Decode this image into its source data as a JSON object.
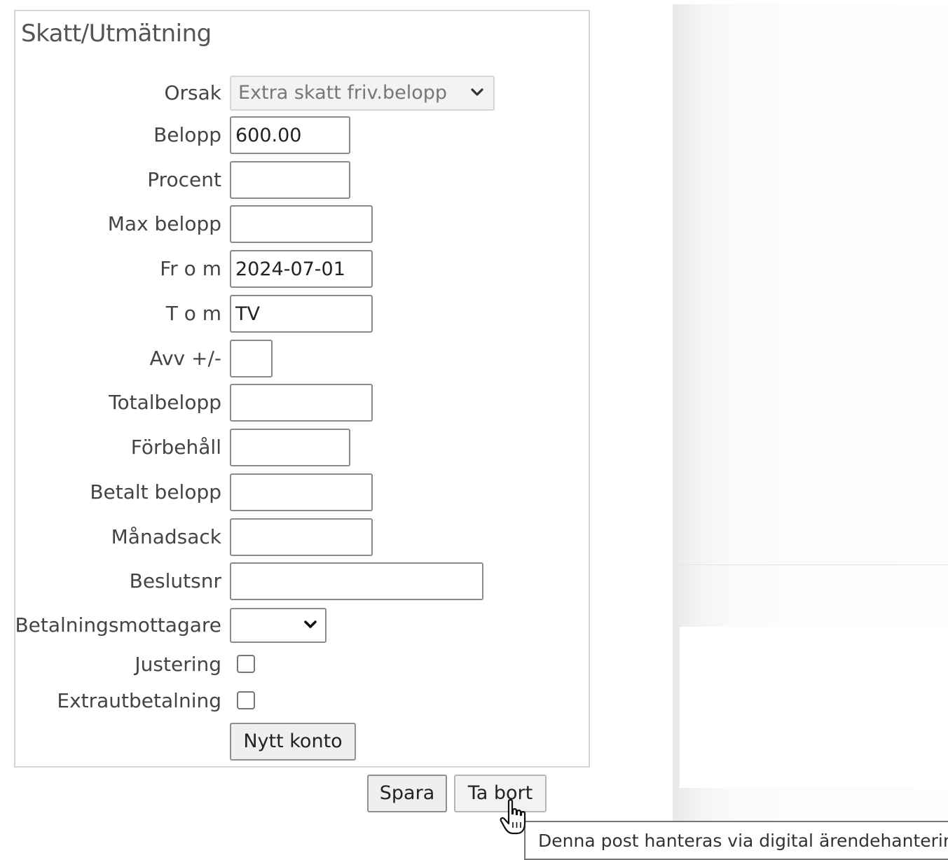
{
  "panel": {
    "title": "Skatt/Utmätning"
  },
  "form": {
    "orsak": {
      "label": "Orsak",
      "value": "Extra skatt friv.belopp"
    },
    "belopp": {
      "label": "Belopp",
      "value": "600.00"
    },
    "procent": {
      "label": "Procent",
      "value": ""
    },
    "max_belopp": {
      "label": "Max belopp",
      "value": ""
    },
    "from": {
      "label": "Fr o m",
      "value": "2024-07-01"
    },
    "tom": {
      "label": "T o m",
      "value": "TV"
    },
    "avv": {
      "label": "Avv +/-",
      "value": ""
    },
    "totalbelopp": {
      "label": "Totalbelopp",
      "value": ""
    },
    "forbehall": {
      "label": "Förbehåll",
      "value": ""
    },
    "betalt_belopp": {
      "label": "Betalt belopp",
      "value": ""
    },
    "manadsack": {
      "label": "Månadsack",
      "value": ""
    },
    "beslutsnr": {
      "label": "Beslutsnr",
      "value": ""
    },
    "betalningsmottagare": {
      "label": "Betalningsmottagare",
      "value": ""
    },
    "justering": {
      "label": "Justering",
      "checked": false
    },
    "extrautbetalning": {
      "label": "Extrautbetalning",
      "checked": false
    },
    "nytt_konto_label": "Nytt konto"
  },
  "actions": {
    "spara_label": "Spara",
    "ta_bort_label": "Ta bort"
  },
  "tooltip": {
    "text": "Denna post hanteras via digital ärendehantering"
  },
  "icons": {
    "select_arrow": "chevron-down-icon",
    "cursor": "hand-pointer-icon"
  }
}
